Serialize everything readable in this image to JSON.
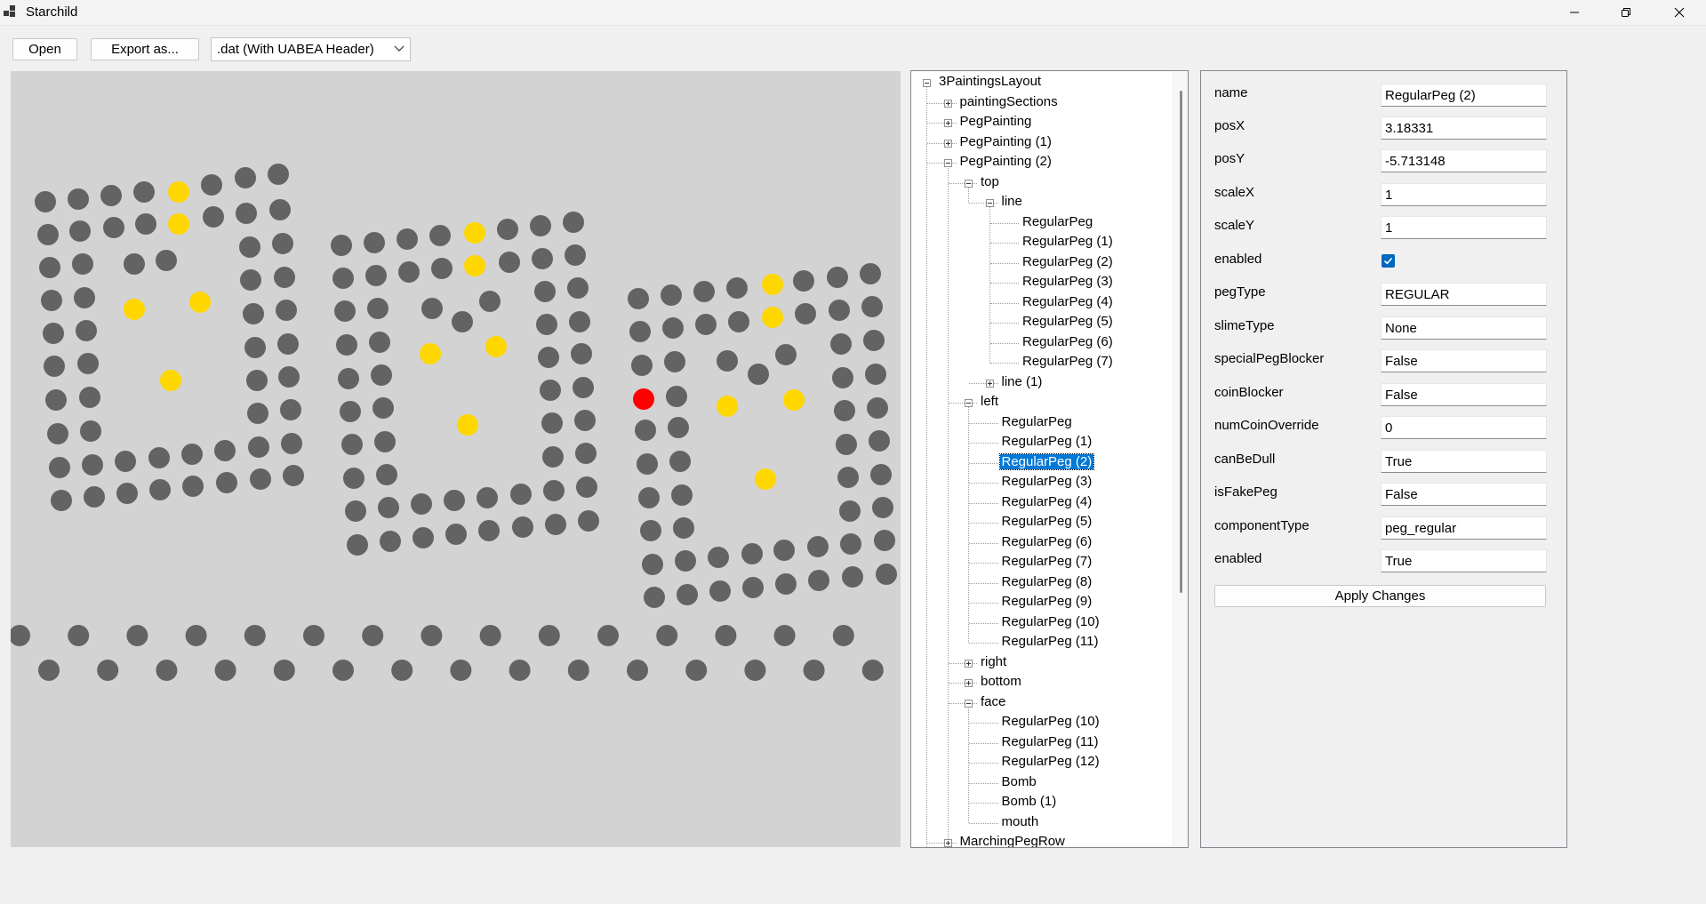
{
  "window": {
    "title": "Starchild"
  },
  "toolbar": {
    "open_label": "Open",
    "export_label": "Export as...",
    "format_selected": ".dat (With UABEA Header)"
  },
  "colors": {
    "canvas_bg": "#d3d3d3",
    "peg_gray": "#636363",
    "peg_yellow": "#ffd700",
    "peg_red": "#ff0000",
    "selection": "#0078d7",
    "check_blue": "#0067c0"
  },
  "tree": {
    "root": "3PaintingsLayout",
    "painting_sections": "paintingSections",
    "peg_painting": "PegPainting",
    "peg_painting_1": "PegPainting (1)",
    "peg_painting_2": "PegPainting (2)",
    "top": "top",
    "line": "line",
    "line_items": [
      "RegularPeg",
      "RegularPeg (1)",
      "RegularPeg (2)",
      "RegularPeg (3)",
      "RegularPeg (4)",
      "RegularPeg (5)",
      "RegularPeg (6)",
      "RegularPeg (7)"
    ],
    "line_1": "line (1)",
    "left": "left",
    "left_items": [
      "RegularPeg",
      "RegularPeg (1)",
      "RegularPeg (2)",
      "RegularPeg (3)",
      "RegularPeg (4)",
      "RegularPeg (5)",
      "RegularPeg (6)",
      "RegularPeg (7)",
      "RegularPeg (8)",
      "RegularPeg (9)",
      "RegularPeg (10)",
      "RegularPeg (11)"
    ],
    "selected": "RegularPeg (2)",
    "right": "right",
    "bottom": "bottom",
    "face": "face",
    "face_items": [
      "RegularPeg (10)",
      "RegularPeg (11)",
      "RegularPeg (12)",
      "Bomb",
      "Bomb (1)",
      "mouth"
    ],
    "marching": "MarchingPegRow"
  },
  "props": {
    "name": {
      "label": "name",
      "value": "RegularPeg (2)"
    },
    "posX": {
      "label": "posX",
      "value": "3.18331"
    },
    "posY": {
      "label": "posY",
      "value": "-5.713148"
    },
    "scaleX": {
      "label": "scaleX",
      "value": "1"
    },
    "scaleY": {
      "label": "scaleY",
      "value": "1"
    },
    "enabled_check": {
      "label": "enabled",
      "checked": true
    },
    "pegType": {
      "label": "pegType",
      "value": "REGULAR"
    },
    "slimeType": {
      "label": "slimeType",
      "value": "None"
    },
    "specialPegBlocker": {
      "label": "specialPegBlocker",
      "value": "False"
    },
    "coinBlocker": {
      "label": "coinBlocker",
      "value": "False"
    },
    "numCoinOverride": {
      "label": "numCoinOverride",
      "value": "0"
    },
    "canBeDull": {
      "label": "canBeDull",
      "value": "True"
    },
    "isFakePeg": {
      "label": "isFakePeg",
      "value": "False"
    },
    "componentType": {
      "label": "componentType",
      "value": "peg_regular"
    },
    "enabled": {
      "label": "enabled",
      "value": "True"
    },
    "apply_label": "Apply Changes"
  }
}
